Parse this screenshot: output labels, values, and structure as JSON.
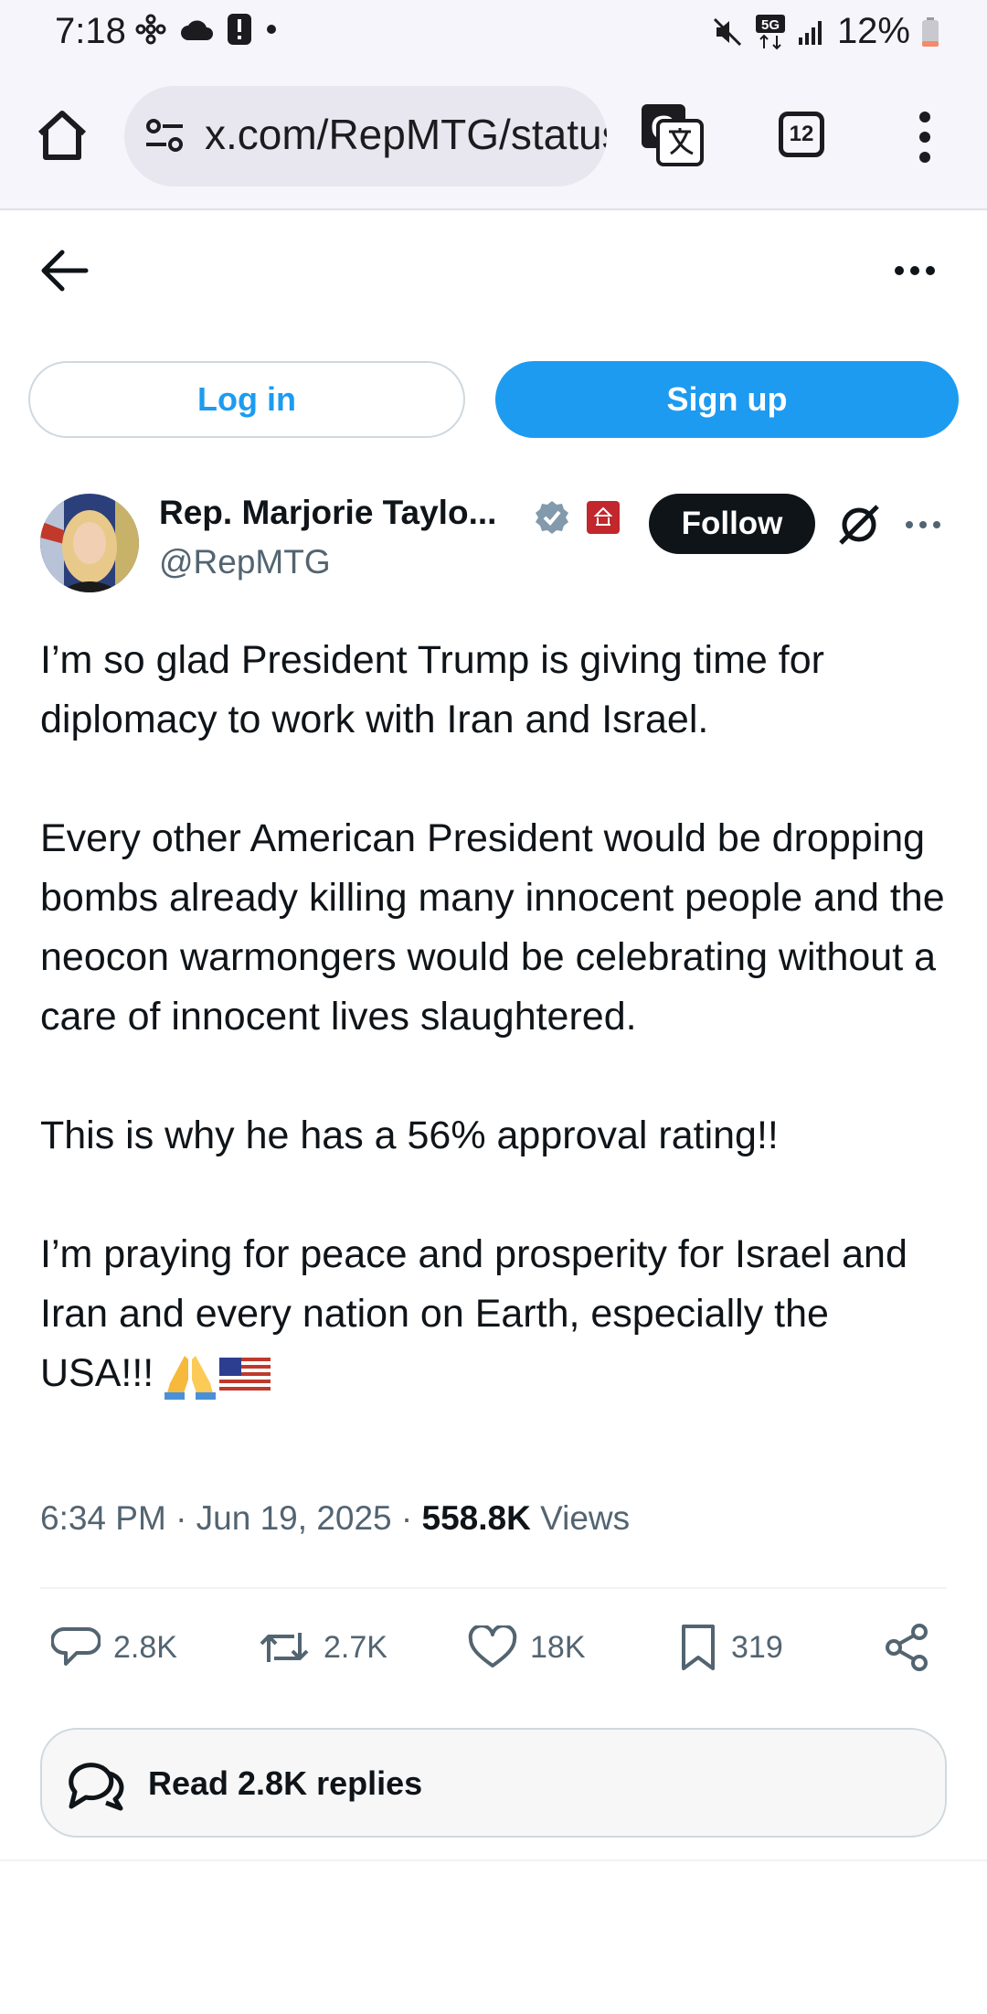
{
  "status_bar": {
    "time": "7:18",
    "battery": "12%",
    "network": "5G"
  },
  "browser": {
    "url": "x.com/RepMTG/status",
    "tab_count": "12"
  },
  "auth": {
    "login_label": "Log in",
    "signup_label": "Sign up"
  },
  "author": {
    "name": "Rep. Marjorie Taylo...",
    "handle": "@RepMTG",
    "follow_label": "Follow"
  },
  "tweet": {
    "p1": "I’m so glad President Trump is giving time for diplomacy to work with Iran and Israel.",
    "p2": "Every other American President would be dropping bombs already killing many innocent people and the neocon warmongers would be celebrating without a care of innocent lives slaughtered.",
    "p3": "This is why he has a 56% approval rating!!",
    "p4": "I’m praying for peace and prosperity for Israel and Iran and every nation on Earth, especially the USA!!!",
    "timestamp": "6:34 PM · Jun 19, 2025 · ",
    "views_count": "558.8K",
    "views_label": " Views"
  },
  "actions": {
    "replies": "2.8K",
    "reposts": "2.7K",
    "likes": "18K",
    "bookmarks": "319"
  },
  "read_replies_label": "Read 2.8K replies",
  "colors": {
    "accent": "#1d9bf0",
    "text": "#0f1419",
    "secondary": "#536471"
  }
}
